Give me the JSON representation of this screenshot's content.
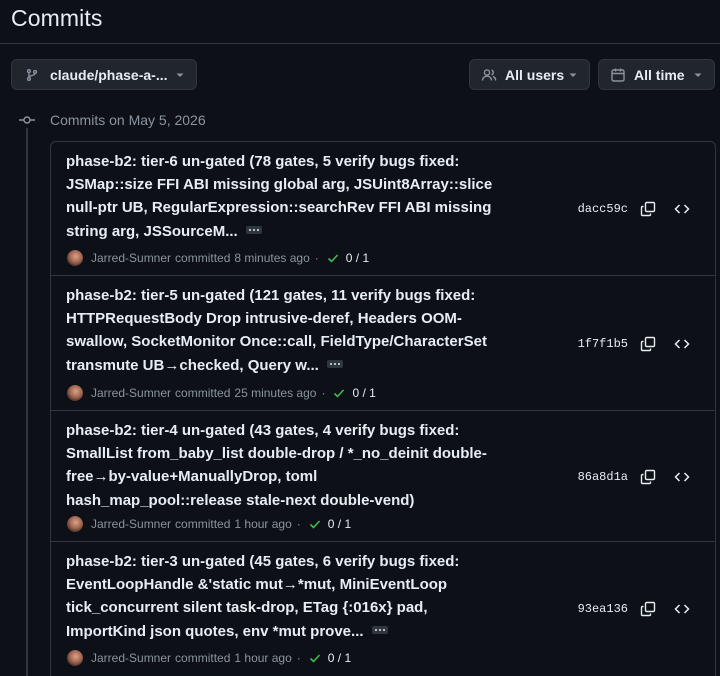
{
  "page": {
    "title": "Commits"
  },
  "filters": {
    "branch_label": "claude/phase-a-...",
    "users_label": "All users",
    "time_label": "All time"
  },
  "group": {
    "label": "Commits on May 5, 2026"
  },
  "commits": [
    {
      "message_lines": [
        "phase-b2: tier-6 un-gated (78 gates, 5 verify bugs fixed:",
        "JSMap::size FFI ABI missing global arg, JSUint8Array::slice",
        "null-ptr UB, RegularExpression::searchRev FFI ABI missing",
        "string arg, JSSourceM..."
      ],
      "author": "Jarred-Sumner",
      "verb": "committed",
      "time": "8 minutes ago",
      "checks": "0 / 1",
      "sha": "dacc59c"
    },
    {
      "message_lines": [
        "phase-b2: tier-5 un-gated (121 gates, 11 verify bugs fixed:",
        "HTTPRequestBody Drop intrusive-deref, Headers OOM-",
        "swallow, SocketMonitor Once::call, FieldType/CharacterSet",
        "transmute UB→checked, Query w..."
      ],
      "author": "Jarred-Sumner",
      "verb": "committed",
      "time": "25 minutes ago",
      "checks": "0 / 1",
      "sha": "1f7f1b5"
    },
    {
      "message_lines": [
        "phase-b2: tier-4 un-gated (43 gates, 4 verify bugs fixed:",
        "SmallList from_baby_list double-drop / *_no_deinit double-",
        "free→by-value+ManuallyDrop, toml",
        "hash_map_pool::release stale-next double-vend)"
      ],
      "author": "Jarred-Sumner",
      "verb": "committed",
      "time": "1 hour ago",
      "checks": "0 / 1",
      "sha": "86a8d1a"
    },
    {
      "message_lines": [
        "phase-b2: tier-3 un-gated (45 gates, 6 verify bugs fixed:",
        "EventLoopHandle &'static mut→*mut, MiniEventLoop",
        "tick_concurrent silent task-drop, ETag {:016x} pad,",
        "ImportKind json quotes, env *mut prove..."
      ],
      "author": "Jarred-Sumner",
      "verb": "committed",
      "time": "1 hour ago",
      "checks": "0 / 1",
      "sha": "93ea136"
    }
  ],
  "icons": {
    "branch": "git-branch-icon",
    "users": "people-icon",
    "calendar": "calendar-icon",
    "caret": "triangle-down-icon",
    "commit": "git-commit-icon",
    "copy": "copy-icon",
    "browse": "code-icon",
    "check": "check-icon",
    "more": "ellipsis-icon"
  },
  "colors": {
    "background": "#0d1117",
    "border": "#30363d",
    "text": "#e6edf3",
    "muted": "#8b949e",
    "success": "#3fb950"
  }
}
